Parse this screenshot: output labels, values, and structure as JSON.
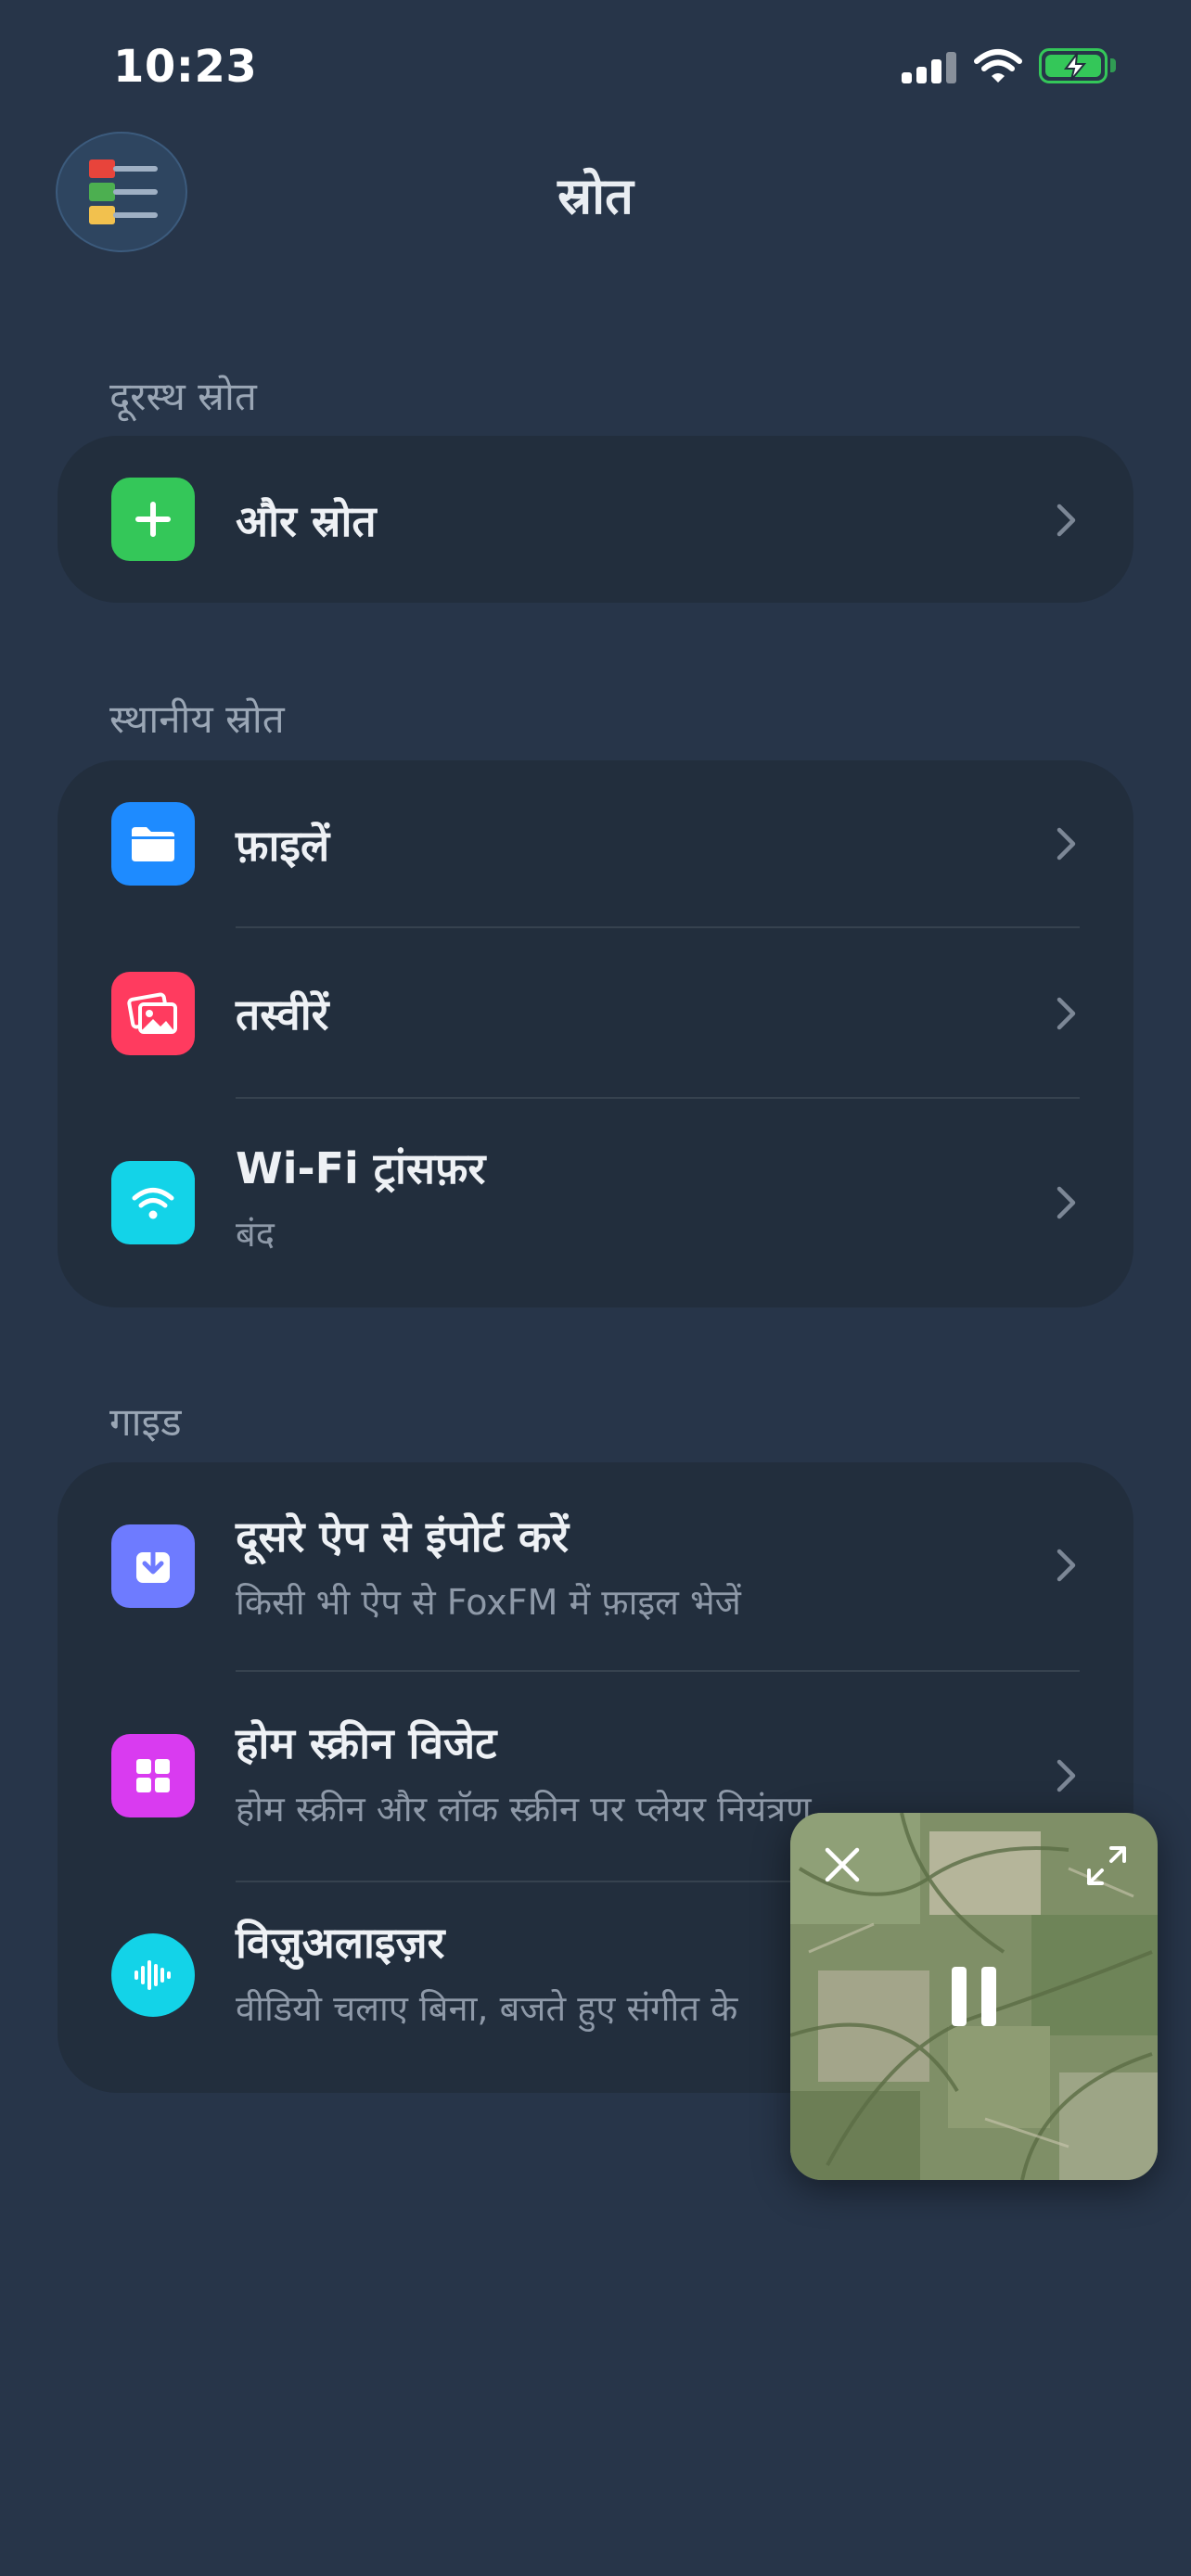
{
  "status_bar": {
    "time": "10:23"
  },
  "header": {
    "title": "स्रोत",
    "menu_icon": "colored-list-menu-icon"
  },
  "sections": {
    "remote": {
      "label": "दूरस्थ स्रोत",
      "items": [
        {
          "title": "और स्रोत",
          "icon": "plus-icon",
          "color": "#34C759"
        }
      ]
    },
    "local": {
      "label": "स्थानीय स्रोत",
      "items": [
        {
          "title": "फ़ाइलें",
          "icon": "folder-icon",
          "color": "#1E8BFF"
        },
        {
          "title": "तस्वीरें",
          "icon": "photos-icon",
          "color": "#FF3B5F"
        },
        {
          "title": "Wi-Fi ट्रांसफ़र",
          "subtitle": "बंद",
          "icon": "wifi-icon",
          "color": "#13D3E8"
        }
      ]
    },
    "guide": {
      "label": "गाइड",
      "items": [
        {
          "title": "दूसरे ऐप से इंपोर्ट करें",
          "subtitle": "किसी भी ऐप से FoxFM में फ़ाइल भेजें",
          "icon": "import-icon",
          "color": "#6E7BFF"
        },
        {
          "title": "होम स्क्रीन विजेट",
          "subtitle": "होम स्क्रीन और लॉक स्क्रीन पर प्लेयर नियंत्रण",
          "icon": "widget-grid-icon",
          "color": "#D93BF0"
        },
        {
          "title": "विज़ुअलाइज़र",
          "subtitle": "वीडियो चलाए बिना, बजते हुए संगीत के",
          "icon": "waveform-icon",
          "color": "#13D3E8"
        }
      ]
    }
  },
  "mini_player": {
    "state": "playing",
    "controls": [
      "close-icon",
      "expand-icon",
      "pause-icon"
    ]
  }
}
